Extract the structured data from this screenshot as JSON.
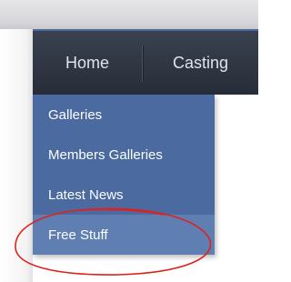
{
  "navbar": {
    "items": [
      {
        "label": "Home"
      },
      {
        "label": "Casting"
      }
    ]
  },
  "dropdown": {
    "items": [
      {
        "label": "Galleries"
      },
      {
        "label": "Members Galleries"
      },
      {
        "label": "Latest News"
      },
      {
        "label": "Free Stuff",
        "highlighted": true
      }
    ]
  },
  "colors": {
    "navbar_bg": "#2b313c",
    "navbar_top_border": "#4b6a9c",
    "dropdown_bg": "#4a6aa0",
    "dropdown_hover_bg": "#5f7fb3",
    "annotation_circle": "#e0201c"
  }
}
